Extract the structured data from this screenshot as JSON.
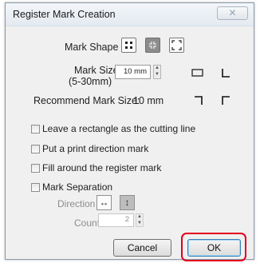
{
  "title": "Register Mark Creation",
  "close_glyph": "✕",
  "mark_shape": {
    "label": "Mark Shape",
    "options": [
      "four-corners-dots-icon",
      "four-corners-inner-icon",
      "four-corners-outer-icon"
    ],
    "selected": 1
  },
  "mark_size": {
    "label_line1": "Mark Size",
    "label_line2": "(5-30mm)",
    "value": "10 mm"
  },
  "recommend": {
    "label": "Recommend Mark Size:",
    "value": "10 mm"
  },
  "options": {
    "leave_rectangle": "Leave a rectangle as the cutting line",
    "print_direction": "Put a print direction mark",
    "fill_around": "Fill around the register mark"
  },
  "separation": {
    "label": "Mark Separation",
    "direction_label": "Direction",
    "horizontal_glyph": "↔",
    "vertical_glyph": "↕",
    "count_label": "Count",
    "count_value": "2"
  },
  "buttons": {
    "cancel": "Cancel",
    "ok": "OK"
  },
  "colors": {
    "highlight": "#e2001a"
  }
}
